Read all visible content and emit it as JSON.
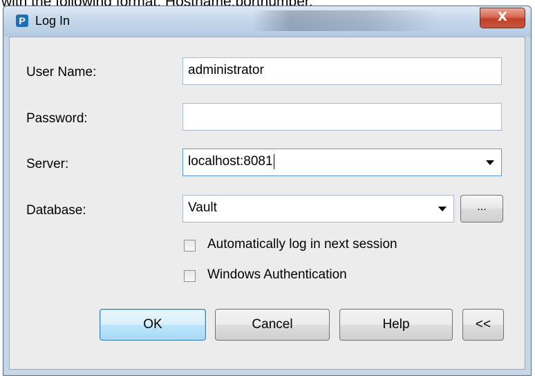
{
  "caption": "with the following format: Hostname:portnumber.",
  "window": {
    "title": "Log In",
    "app_icon": "P",
    "close_glyph": "X"
  },
  "form": {
    "username": {
      "label": "User Name:",
      "value": "administrator"
    },
    "password": {
      "label": "Password:",
      "value": ""
    },
    "server": {
      "label": "Server:",
      "value": "localhost:8081"
    },
    "database": {
      "label": "Database:",
      "value": "Vault",
      "browse_label": "..."
    }
  },
  "options": [
    {
      "label": "Automatically log in next session",
      "checked": false
    },
    {
      "label": "Windows Authentication",
      "checked": false
    }
  ],
  "buttons": {
    "ok": "OK",
    "cancel": "Cancel",
    "help": "Help",
    "collapse": "<<"
  },
  "colors": {
    "accent": "#5b9ad8",
    "close_red": "#c0412a"
  },
  "icons": [
    "app-icon",
    "close-icon",
    "dropdown-arrow-icon"
  ]
}
